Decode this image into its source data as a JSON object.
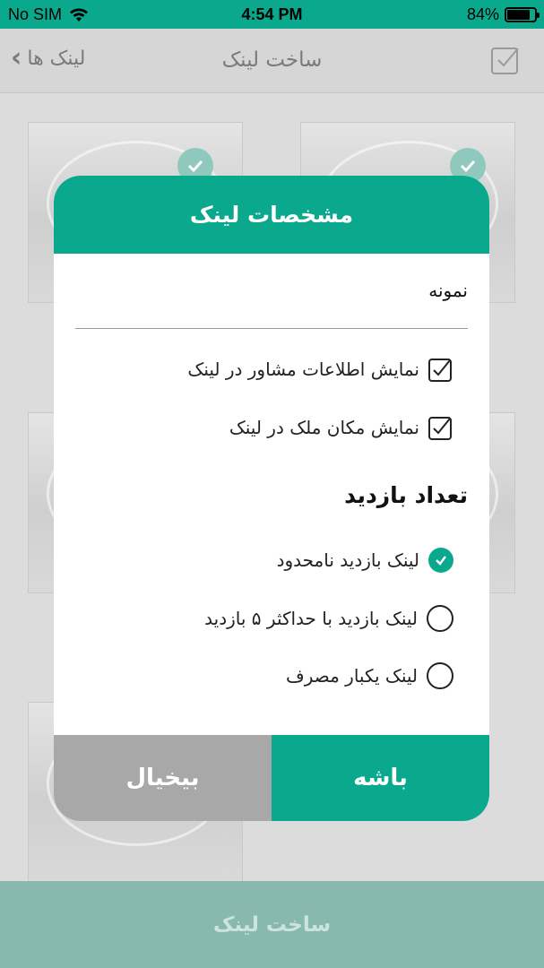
{
  "status_bar": {
    "carrier": "No SIM",
    "time": "4:54 PM",
    "battery_percent": "84%",
    "battery_level": 0.84
  },
  "nav": {
    "title": "ساخت لینک",
    "back_label": "لینک ها",
    "back_icon": "chevron-left-icon",
    "select_icon": "checkbox-icon"
  },
  "dialog": {
    "title": "مشخصات لینک",
    "name_value": "نمونه",
    "options": [
      {
        "label": "نمایش اطلاعات مشاور در لینک",
        "checked": true
      },
      {
        "label": "نمایش مکان ملک در لینک",
        "checked": true
      }
    ],
    "visits_title": "تعداد بازدید",
    "visit_choices": [
      {
        "label": "لینک بازدید نامحدود",
        "selected": true
      },
      {
        "label": "لینک بازدید با حداکثر ۵ بازدید",
        "selected": false
      },
      {
        "label": "لینک یکبار مصرف",
        "selected": false
      }
    ],
    "ok_label": "باشه",
    "cancel_label": "بیخیال"
  },
  "bottom_button_label": "ساخت لینک",
  "colors": {
    "accent": "#0aa98e",
    "cancel": "#a8a8a8",
    "bottom_bar": "#87b9ae"
  }
}
